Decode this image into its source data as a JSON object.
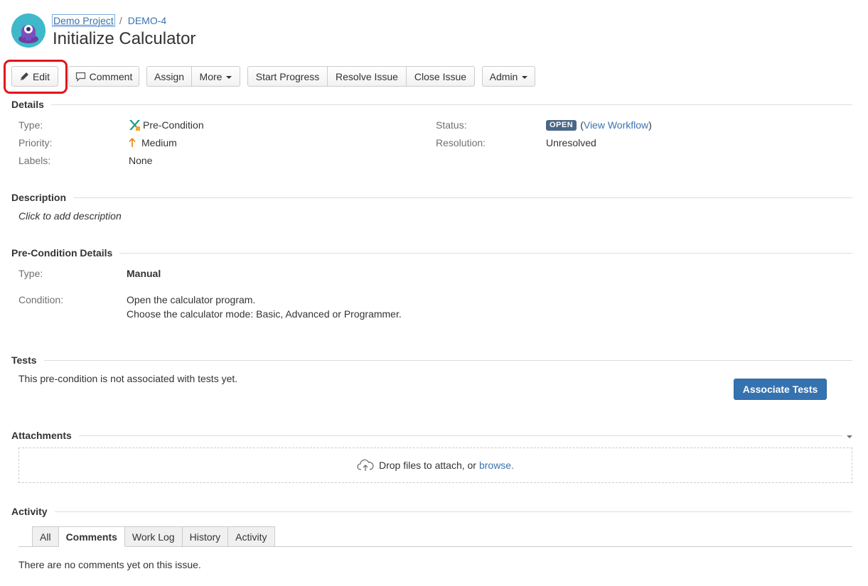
{
  "header": {
    "breadcrumb_project": "Demo Project",
    "breadcrumb_sep": "/",
    "breadcrumb_key": "DEMO-4",
    "title": "Initialize Calculator"
  },
  "toolbar": {
    "edit": "Edit",
    "comment": "Comment",
    "assign": "Assign",
    "more": "More",
    "start_progress": "Start Progress",
    "resolve_issue": "Resolve Issue",
    "close_issue": "Close Issue",
    "admin": "Admin"
  },
  "details": {
    "heading": "Details",
    "type_label": "Type:",
    "type_value": "Pre-Condition",
    "priority_label": "Priority:",
    "priority_value": "Medium",
    "labels_label": "Labels:",
    "labels_value": "None",
    "status_label": "Status:",
    "status_value": "OPEN",
    "view_workflow_open": "(",
    "view_workflow": "View Workflow",
    "view_workflow_close": ")",
    "resolution_label": "Resolution:",
    "resolution_value": "Unresolved"
  },
  "description": {
    "heading": "Description",
    "placeholder": "Click to add description"
  },
  "precondition": {
    "heading": "Pre-Condition Details",
    "type_label": "Type:",
    "type_value": "Manual",
    "condition_label": "Condition:",
    "condition_line1": "Open the calculator program.",
    "condition_line2": "Choose the calculator mode: Basic, Advanced or Programmer."
  },
  "tests": {
    "heading": "Tests",
    "message": "This pre-condition is not associated with tests yet.",
    "associate_button": "Associate Tests"
  },
  "attachments": {
    "heading": "Attachments",
    "drop_text": "Drop files to attach, or",
    "browse": "browse."
  },
  "activity": {
    "heading": "Activity",
    "tabs": [
      "All",
      "Comments",
      "Work Log",
      "History",
      "Activity"
    ],
    "active_tab": "Comments",
    "empty_message": "There are no comments yet on this issue."
  },
  "colors": {
    "link": "#3b73af",
    "primary_button": "#3572b0",
    "status_lozenge": "#4a6785",
    "highlight": "#e3131b",
    "priority_arrow": "#e8820c"
  }
}
